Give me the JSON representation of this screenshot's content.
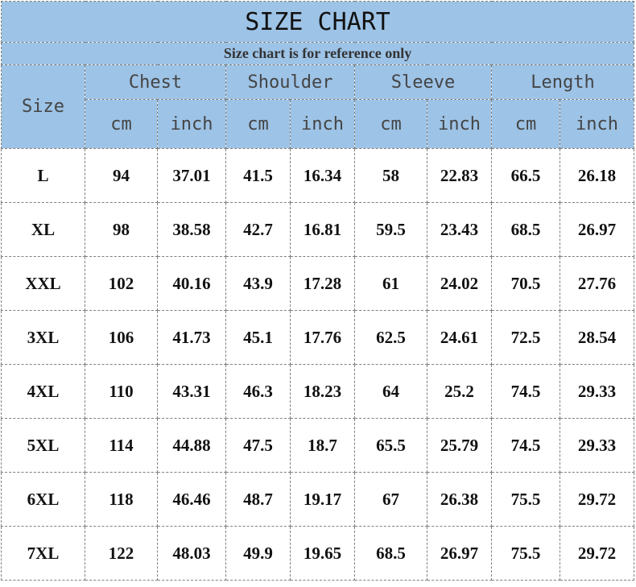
{
  "title": "SIZE CHART",
  "note": "Size chart is for reference only",
  "size_header": "Size",
  "groups": [
    "Chest",
    "Shoulder",
    "Sleeve",
    "Length"
  ],
  "units": [
    "cm",
    "inch",
    "cm",
    "inch",
    "cm",
    "inch",
    "cm",
    "inch"
  ],
  "rows": [
    [
      "L",
      "94",
      "37.01",
      "41.5",
      "16.34",
      "58",
      "22.83",
      "66.5",
      "26.18"
    ],
    [
      "XL",
      "98",
      "38.58",
      "42.7",
      "16.81",
      "59.5",
      "23.43",
      "68.5",
      "26.97"
    ],
    [
      "XXL",
      "102",
      "40.16",
      "43.9",
      "17.28",
      "61",
      "24.02",
      "70.5",
      "27.76"
    ],
    [
      "3XL",
      "106",
      "41.73",
      "45.1",
      "17.76",
      "62.5",
      "24.61",
      "72.5",
      "28.54"
    ],
    [
      "4XL",
      "110",
      "43.31",
      "46.3",
      "18.23",
      "64",
      "25.2",
      "74.5",
      "29.33"
    ],
    [
      "5XL",
      "114",
      "44.88",
      "47.5",
      "18.7",
      "65.5",
      "25.79",
      "74.5",
      "29.33"
    ],
    [
      "6XL",
      "118",
      "46.46",
      "48.7",
      "19.17",
      "67",
      "26.38",
      "75.5",
      "29.72"
    ],
    [
      "7XL",
      "122",
      "48.03",
      "49.9",
      "19.65",
      "68.5",
      "26.97",
      "75.5",
      "29.72"
    ]
  ],
  "colors": {
    "header_blue": "#9dc3e6",
    "border": "#7f7f7f",
    "text": "#111111"
  }
}
